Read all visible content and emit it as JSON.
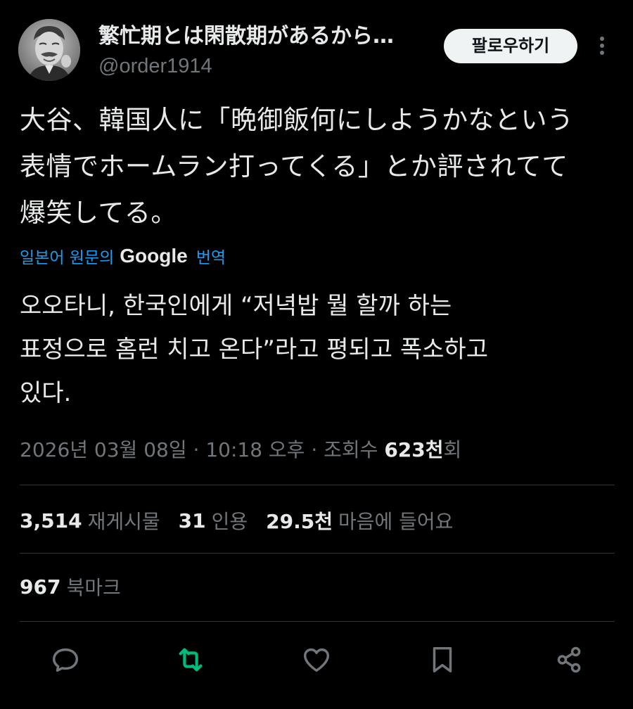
{
  "header": {
    "display_name": "繁忙期とは閑散期があるから…",
    "handle": "@order1914",
    "follow_label": "팔로우하기",
    "more_icon": "more-vertical-icon"
  },
  "tweet": {
    "text_lines": [
      "大谷、韓国人に「晩御飯何にしようかなという",
      "表情でホームラン打ってくる」とか評されてて",
      "爆笑してる。"
    ],
    "translate": {
      "prefix": "일본어 원문의",
      "provider": "Google",
      "suffix": "번역"
    },
    "translated_lines": [
      "오오타니, 한국인에게 “저녁밥 뭘 할까 하는",
      "표정으로 홈런 치고 온다”라고 평되고 폭소하고",
      "있다."
    ]
  },
  "meta": {
    "date": "2026년 03월 08일",
    "sep1": " · ",
    "time": "10:18 오후",
    "sep2": " · ",
    "views_label": "조회수 ",
    "views_value": "623천",
    "views_suffix": "회"
  },
  "stats": {
    "reposts_count": "3,514",
    "reposts_label": "재게시물",
    "quotes_count": "31",
    "quotes_label": "인용",
    "likes_count": "29.5천",
    "likes_label": "마음에 들어요",
    "bookmarks_count": "967",
    "bookmarks_label": "북마크"
  },
  "actions": {
    "reply_icon": "reply-icon",
    "repost_icon": "repost-icon",
    "like_icon": "heart-icon",
    "bookmark_icon": "bookmark-icon",
    "share_icon": "share-icon",
    "repost_color": "#00ba7c",
    "icon_color": "#71767b"
  }
}
